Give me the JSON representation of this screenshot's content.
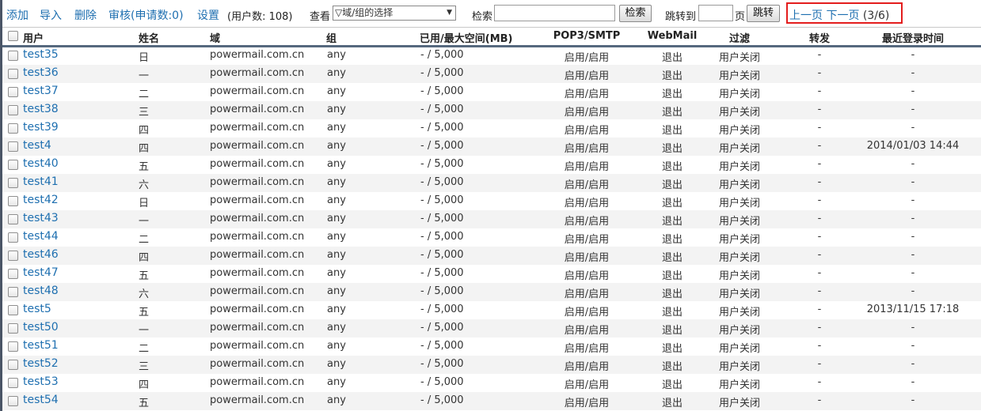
{
  "toolbar": {
    "add": "添加",
    "import": "导入",
    "delete": "删除",
    "review": "审核(申请数:0)",
    "settings": "设置",
    "user_count": "(用户数: 108)",
    "view_label": "查看",
    "view_select": "▽域/组的选择",
    "search_label": "检索",
    "search_value": "",
    "search_button": "检索",
    "jump_label": "跳转到",
    "jump_value": "",
    "page_unit": "页",
    "jump_button": "跳转"
  },
  "pager": {
    "prev": "上一页",
    "next": "下一页",
    "current": "(3/6)"
  },
  "table": {
    "headers": {
      "user": "用户",
      "name": "姓名",
      "domain": "域",
      "group": "组",
      "space": "已用/最大空间(MB)",
      "pop": "POP3/SMTP",
      "webmail": "WebMail",
      "filter": "过滤",
      "forward": "转发",
      "last_login": "最近登录时间"
    },
    "rows": [
      {
        "user": "test35",
        "name": "日",
        "domain": "powermail.com.cn",
        "group": "any",
        "space": "- / 5,000",
        "pop": "启用/启用",
        "webmail": "退出",
        "filter": "用户关闭",
        "forward": "-",
        "last_login": "-"
      },
      {
        "user": "test36",
        "name": "一",
        "domain": "powermail.com.cn",
        "group": "any",
        "space": "- / 5,000",
        "pop": "启用/启用",
        "webmail": "退出",
        "filter": "用户关闭",
        "forward": "-",
        "last_login": "-"
      },
      {
        "user": "test37",
        "name": "二",
        "domain": "powermail.com.cn",
        "group": "any",
        "space": "- / 5,000",
        "pop": "启用/启用",
        "webmail": "退出",
        "filter": "用户关闭",
        "forward": "-",
        "last_login": "-"
      },
      {
        "user": "test38",
        "name": "三",
        "domain": "powermail.com.cn",
        "group": "any",
        "space": "- / 5,000",
        "pop": "启用/启用",
        "webmail": "退出",
        "filter": "用户关闭",
        "forward": "-",
        "last_login": "-"
      },
      {
        "user": "test39",
        "name": "四",
        "domain": "powermail.com.cn",
        "group": "any",
        "space": "- / 5,000",
        "pop": "启用/启用",
        "webmail": "退出",
        "filter": "用户关闭",
        "forward": "-",
        "last_login": "-"
      },
      {
        "user": "test4",
        "name": "四",
        "domain": "powermail.com.cn",
        "group": "any",
        "space": "- / 5,000",
        "pop": "启用/启用",
        "webmail": "退出",
        "filter": "用户关闭",
        "forward": "-",
        "last_login": "2014/01/03 14:44"
      },
      {
        "user": "test40",
        "name": "五",
        "domain": "powermail.com.cn",
        "group": "any",
        "space": "- / 5,000",
        "pop": "启用/启用",
        "webmail": "退出",
        "filter": "用户关闭",
        "forward": "-",
        "last_login": "-"
      },
      {
        "user": "test41",
        "name": "六",
        "domain": "powermail.com.cn",
        "group": "any",
        "space": "- / 5,000",
        "pop": "启用/启用",
        "webmail": "退出",
        "filter": "用户关闭",
        "forward": "-",
        "last_login": "-"
      },
      {
        "user": "test42",
        "name": "日",
        "domain": "powermail.com.cn",
        "group": "any",
        "space": "- / 5,000",
        "pop": "启用/启用",
        "webmail": "退出",
        "filter": "用户关闭",
        "forward": "-",
        "last_login": "-"
      },
      {
        "user": "test43",
        "name": "一",
        "domain": "powermail.com.cn",
        "group": "any",
        "space": "- / 5,000",
        "pop": "启用/启用",
        "webmail": "退出",
        "filter": "用户关闭",
        "forward": "-",
        "last_login": "-"
      },
      {
        "user": "test44",
        "name": "二",
        "domain": "powermail.com.cn",
        "group": "any",
        "space": "- / 5,000",
        "pop": "启用/启用",
        "webmail": "退出",
        "filter": "用户关闭",
        "forward": "-",
        "last_login": "-"
      },
      {
        "user": "test46",
        "name": "四",
        "domain": "powermail.com.cn",
        "group": "any",
        "space": "- / 5,000",
        "pop": "启用/启用",
        "webmail": "退出",
        "filter": "用户关闭",
        "forward": "-",
        "last_login": "-"
      },
      {
        "user": "test47",
        "name": "五",
        "domain": "powermail.com.cn",
        "group": "any",
        "space": "- / 5,000",
        "pop": "启用/启用",
        "webmail": "退出",
        "filter": "用户关闭",
        "forward": "-",
        "last_login": "-"
      },
      {
        "user": "test48",
        "name": "六",
        "domain": "powermail.com.cn",
        "group": "any",
        "space": "- / 5,000",
        "pop": "启用/启用",
        "webmail": "退出",
        "filter": "用户关闭",
        "forward": "-",
        "last_login": "-"
      },
      {
        "user": "test5",
        "name": "五",
        "domain": "powermail.com.cn",
        "group": "any",
        "space": "- / 5,000",
        "pop": "启用/启用",
        "webmail": "退出",
        "filter": "用户关闭",
        "forward": "-",
        "last_login": "2013/11/15 17:18"
      },
      {
        "user": "test50",
        "name": "一",
        "domain": "powermail.com.cn",
        "group": "any",
        "space": "- / 5,000",
        "pop": "启用/启用",
        "webmail": "退出",
        "filter": "用户关闭",
        "forward": "-",
        "last_login": "-"
      },
      {
        "user": "test51",
        "name": "二",
        "domain": "powermail.com.cn",
        "group": "any",
        "space": "- / 5,000",
        "pop": "启用/启用",
        "webmail": "退出",
        "filter": "用户关闭",
        "forward": "-",
        "last_login": "-"
      },
      {
        "user": "test52",
        "name": "三",
        "domain": "powermail.com.cn",
        "group": "any",
        "space": "- / 5,000",
        "pop": "启用/启用",
        "webmail": "退出",
        "filter": "用户关闭",
        "forward": "-",
        "last_login": "-"
      },
      {
        "user": "test53",
        "name": "四",
        "domain": "powermail.com.cn",
        "group": "any",
        "space": "- / 5,000",
        "pop": "启用/启用",
        "webmail": "退出",
        "filter": "用户关闭",
        "forward": "-",
        "last_login": "-"
      },
      {
        "user": "test54",
        "name": "五",
        "domain": "powermail.com.cn",
        "group": "any",
        "space": "- / 5,000",
        "pop": "启用/启用",
        "webmail": "退出",
        "filter": "用户关闭",
        "forward": "-",
        "last_login": "-"
      }
    ]
  }
}
